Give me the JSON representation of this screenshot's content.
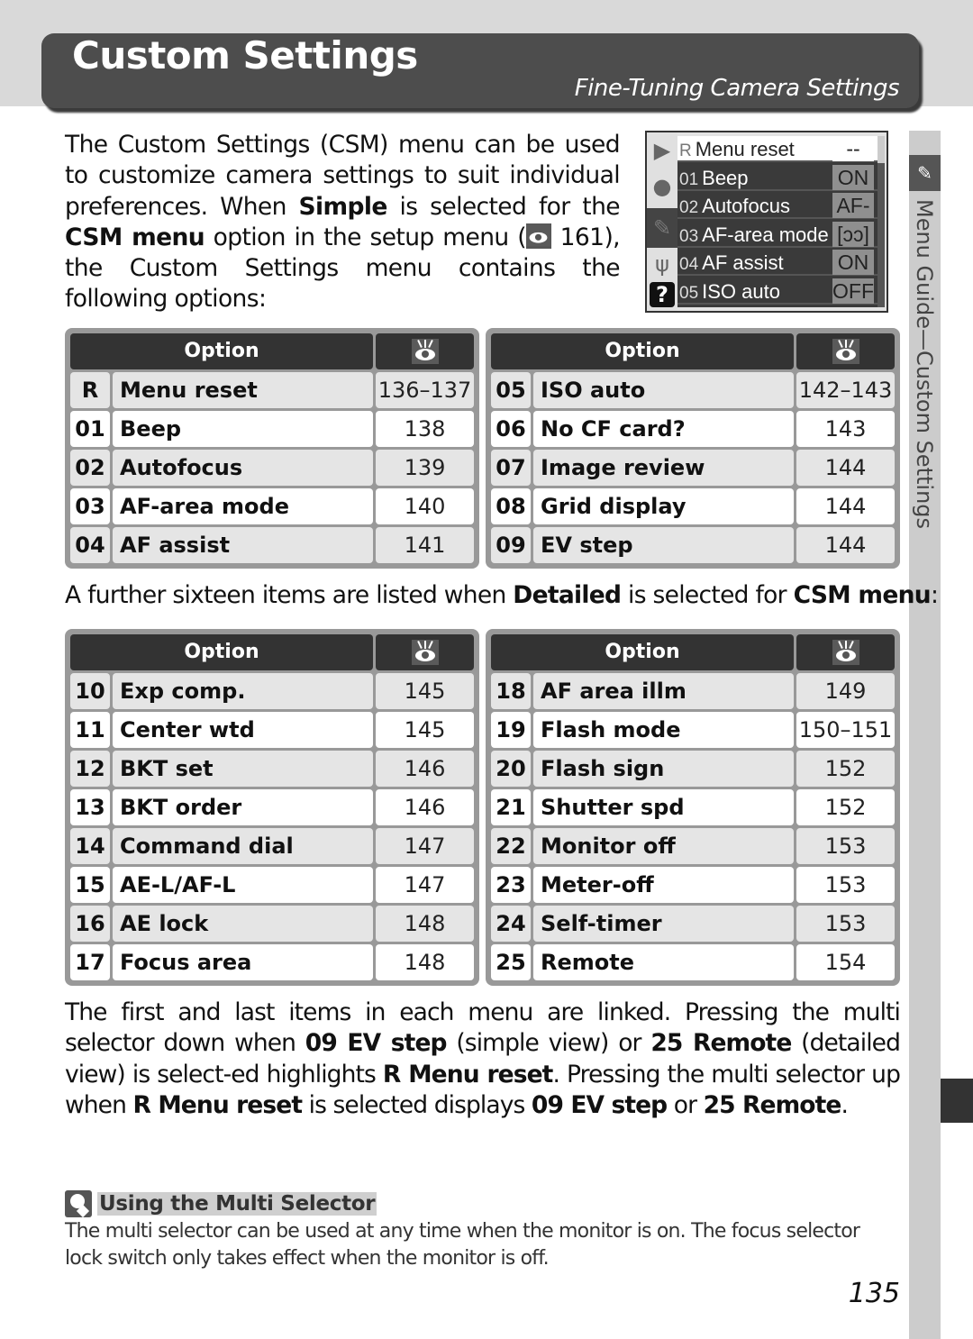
{
  "header": {
    "title": "Custom Settings",
    "subtitle": "Fine-Tuning Camera Settings"
  },
  "intro": {
    "t1": "The Custom Settings (CSM) menu can be used to customize camera settings to suit individual preferences.  When ",
    "b1": "Simple",
    "t2": " is selected for the ",
    "b2": "CSM menu",
    "t3": " option in the setup menu (",
    "ref_icon": "page-reference-eye-icon",
    "t4": " 161), the Custom Settings menu contains the following options:"
  },
  "lcd": {
    "tabs": [
      "playback-icon",
      "camera-icon",
      "pencil-icon",
      "wrench-icon",
      "help-icon"
    ],
    "help_glyph": "?",
    "rows": [
      {
        "num": "R",
        "label": "Menu reset",
        "value": "--",
        "selected": true
      },
      {
        "num": "01",
        "label": "Beep",
        "value": "ON"
      },
      {
        "num": "02",
        "label": "Autofocus",
        "value": "AF-S"
      },
      {
        "num": "03",
        "label": "AF-area mode",
        "value": "[ɔɔ]"
      },
      {
        "num": "04",
        "label": "AF assist",
        "value": "ON"
      },
      {
        "num": "05",
        "label": "ISO auto",
        "value": "OFF"
      }
    ]
  },
  "side_tab": {
    "label": "Menu Guide—Custom Settings",
    "icon": "pencil-icon"
  },
  "table_header": {
    "option": "Option",
    "page_icon": "page-reference-eye-icon"
  },
  "simple_tables": [
    {
      "rows": [
        {
          "num": "R",
          "name": "Menu reset",
          "page": "136–137"
        },
        {
          "num": "01",
          "name": "Beep",
          "page": "138"
        },
        {
          "num": "02",
          "name": "Autofocus",
          "page": "139"
        },
        {
          "num": "03",
          "name": "AF-area mode",
          "page": "140"
        },
        {
          "num": "04",
          "name": "AF assist",
          "page": "141"
        }
      ]
    },
    {
      "rows": [
        {
          "num": "05",
          "name": "ISO auto",
          "page": "142–143"
        },
        {
          "num": "06",
          "name": "No CF card?",
          "page": "143"
        },
        {
          "num": "07",
          "name": "Image review",
          "page": "144"
        },
        {
          "num": "08",
          "name": "Grid display",
          "page": "144"
        },
        {
          "num": "09",
          "name": "EV step",
          "page": "144"
        }
      ]
    }
  ],
  "mid": {
    "t1": "A further sixteen items are listed when ",
    "b1": "Detailed",
    "t2": " is selected for ",
    "b2": "CSM menu",
    "t3": ":"
  },
  "detailed_tables": [
    {
      "rows": [
        {
          "num": "10",
          "name": "Exp comp.",
          "page": "145"
        },
        {
          "num": "11",
          "name": "Center wtd",
          "page": "145"
        },
        {
          "num": "12",
          "name": "BKT set",
          "page": "146"
        },
        {
          "num": "13",
          "name": "BKT order",
          "page": "146"
        },
        {
          "num": "14",
          "name": "Command dial",
          "page": "147"
        },
        {
          "num": "15",
          "name": "AE-L/AF-L",
          "page": "147"
        },
        {
          "num": "16",
          "name": "AE lock",
          "page": "148"
        },
        {
          "num": "17",
          "name": "Focus area",
          "page": "148"
        }
      ]
    },
    {
      "rows": [
        {
          "num": "18",
          "name": "AF area illm",
          "page": "149"
        },
        {
          "num": "19",
          "name": "Flash mode",
          "page": "150–151"
        },
        {
          "num": "20",
          "name": "Flash sign",
          "page": "152"
        },
        {
          "num": "21",
          "name": "Shutter spd",
          "page": "152"
        },
        {
          "num": "22",
          "name": "Monitor off",
          "page": "153"
        },
        {
          "num": "23",
          "name": "Meter-off",
          "page": "153"
        },
        {
          "num": "24",
          "name": "Self-timer",
          "page": "153"
        },
        {
          "num": "25",
          "name": "Remote",
          "page": "154"
        }
      ]
    }
  ],
  "para2": {
    "t1": "The first and last items in each menu are linked.  Pressing the multi selector down when ",
    "b1": "09 EV step",
    "t2": " (simple view) or ",
    "b2": "25 Remote",
    "t3": " (detailed view) is select-ed highlights ",
    "b3": "R Menu reset",
    "t4": ".  Pressing the multi selector up when ",
    "b4": "R Menu reset",
    "t5": " is selected displays ",
    "b5": "09 EV step",
    "t6": " or ",
    "b6": "25 Remote",
    "t7": "."
  },
  "note": {
    "icon": "magnifier-tip-icon",
    "title": "Using the Multi Selector",
    "body": "The multi selector can be used at any time when the monitor is on.  The focus selector lock switch only takes effect when the monitor is off."
  },
  "page_number": "135"
}
